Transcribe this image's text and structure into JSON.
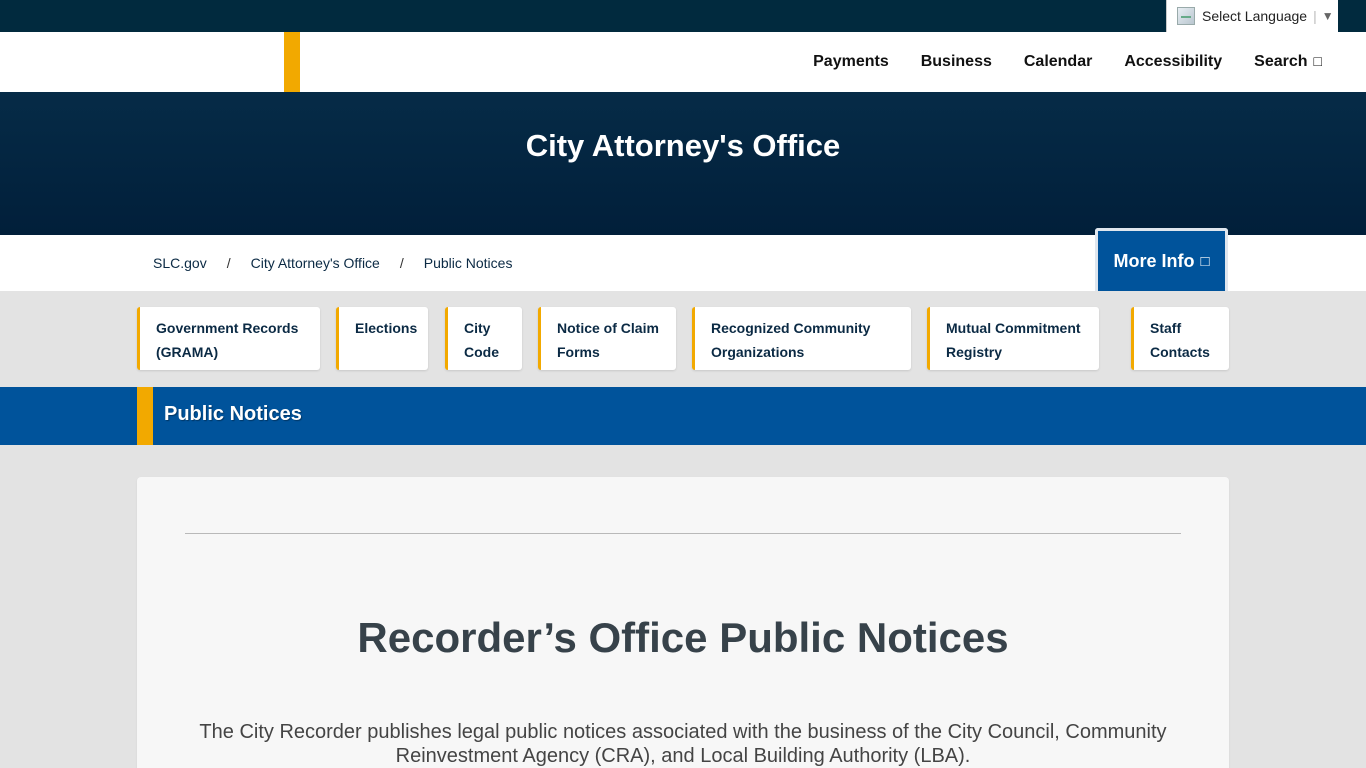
{
  "language": {
    "label": "Select Language",
    "caret": "▼"
  },
  "nav": {
    "items": [
      "Payments",
      "Business",
      "Calendar",
      "Accessibility"
    ],
    "search_label": "Search",
    "search_icon": "search-icon"
  },
  "hero": {
    "title": "City Attorney's Office"
  },
  "breadcrumb": {
    "items": [
      "SLC.gov",
      "City Attorney's Office",
      "Public Notices"
    ],
    "separator": "/"
  },
  "more_info": {
    "label": "More Info",
    "icon": "list-icon"
  },
  "quick_links": [
    {
      "line1": "Government Records",
      "line2": "(GRAMA)"
    },
    {
      "line1": "Elections",
      "line2": ""
    },
    {
      "line1": "City",
      "line2": "Code"
    },
    {
      "line1": "Notice of Claim",
      "line2": "Forms"
    },
    {
      "line1": "Recognized Community",
      "line2": "Organizations"
    },
    {
      "line1": "Mutual Commitment",
      "line2": "Registry"
    },
    {
      "line1": "Staff",
      "line2": "Contacts"
    }
  ],
  "section": {
    "title": "Public Notices"
  },
  "content": {
    "heading": "Recorder’s Office Public Notices",
    "paragraph": "The City Recorder publishes legal public notices associated with the business of the City Council, Community Reinvestment Agency (CRA), and Local Building Authority (LBA)."
  },
  "colors": {
    "navy": "#012a3e",
    "gold": "#f2a900",
    "blue": "#00539b"
  }
}
